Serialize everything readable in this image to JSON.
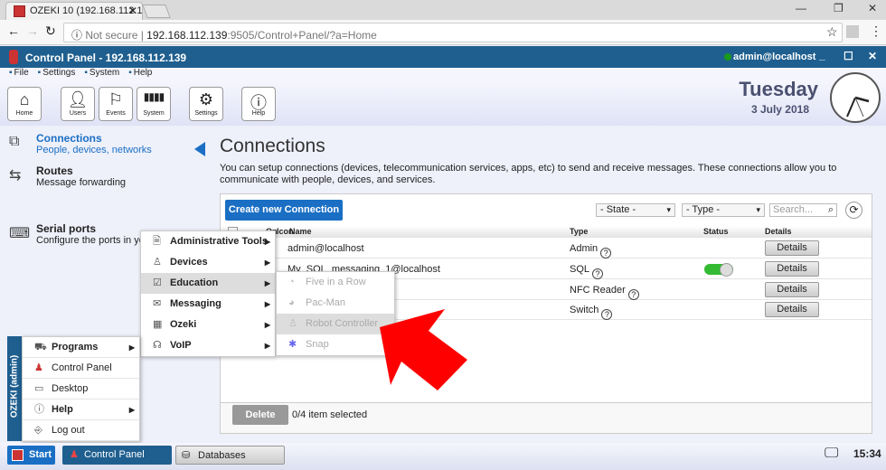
{
  "browser": {
    "tab_title": "OZEKI 10 (192.168.112.139",
    "url_host": "192.168.112.139",
    "url_rest": ":9505/Control+Panel/?a=Home",
    "security": "Not secure"
  },
  "app": {
    "title": "Control Panel - 192.168.112.139",
    "user": "admin@localhost",
    "user_status_color": "#1a9a1a",
    "accent": "#1f5f8f"
  },
  "menubar": [
    "File",
    "Settings",
    "System",
    "Help"
  ],
  "toolbar": [
    {
      "label": "Home",
      "icon": "home-icon"
    },
    {
      "label": "Users",
      "icon": "user-icon"
    },
    {
      "label": "Events",
      "icon": "flag-icon"
    },
    {
      "label": "System",
      "icon": "bars-icon"
    },
    {
      "label": "Settings",
      "icon": "gear-icon"
    },
    {
      "label": "Help",
      "icon": "info-icon"
    }
  ],
  "datetime": {
    "day": "Tuesday",
    "date": "3 July 2018",
    "time": "15:34"
  },
  "sidebar": [
    {
      "title": "Connections",
      "sub": "People, devices, networks",
      "active": true
    },
    {
      "title": "Routes",
      "sub": "Message forwarding"
    },
    {
      "title": "Serial ports",
      "sub": "Configure the ports in your"
    }
  ],
  "page": {
    "title": "Connections",
    "description": "You can setup connections (devices, telecommunication services, apps, etc) to send and receive messages. These connections allow you to communicate with people, devices, and services.",
    "create_button": "Create new Connection",
    "state_filter": "- State -",
    "type_filter": "- Type -",
    "search_placeholder": "Search...",
    "delete_button": "Delete",
    "selection": "0/4 item selected"
  },
  "table": {
    "headers": [
      "On",
      "Icon",
      "Name",
      "Type",
      "Status",
      "Details"
    ],
    "rows": [
      {
        "name": "admin@localhost",
        "type": "Admin",
        "status": "",
        "details": "Details"
      },
      {
        "name": "My_SQL_messaging_1@localhost",
        "type": "SQL",
        "status": "on",
        "details": "Details"
      },
      {
        "name": "",
        "type": "NFC Reader",
        "status": "",
        "details": "Details"
      },
      {
        "name": "",
        "type": "Switch",
        "status": "",
        "details": "Details"
      }
    ]
  },
  "programs_menu": [
    {
      "label": "Administrative Tools"
    },
    {
      "label": "Devices"
    },
    {
      "label": "Education",
      "highlighted": true
    },
    {
      "label": "Messaging"
    },
    {
      "label": "Ozeki"
    },
    {
      "label": "VoIP"
    }
  ],
  "education_menu": [
    {
      "label": "Five in a Row"
    },
    {
      "label": "Pac-Man"
    },
    {
      "label": "Robot Controller",
      "highlighted": true
    },
    {
      "label": "Snap"
    }
  ],
  "start_menu": {
    "strip": "OZEKI (admin)",
    "items": [
      "Programs",
      "Control Panel",
      "Desktop",
      "Help",
      "Log out"
    ]
  },
  "taskbar": {
    "start": "Start",
    "apps": [
      "Control Panel",
      "Databases"
    ]
  }
}
